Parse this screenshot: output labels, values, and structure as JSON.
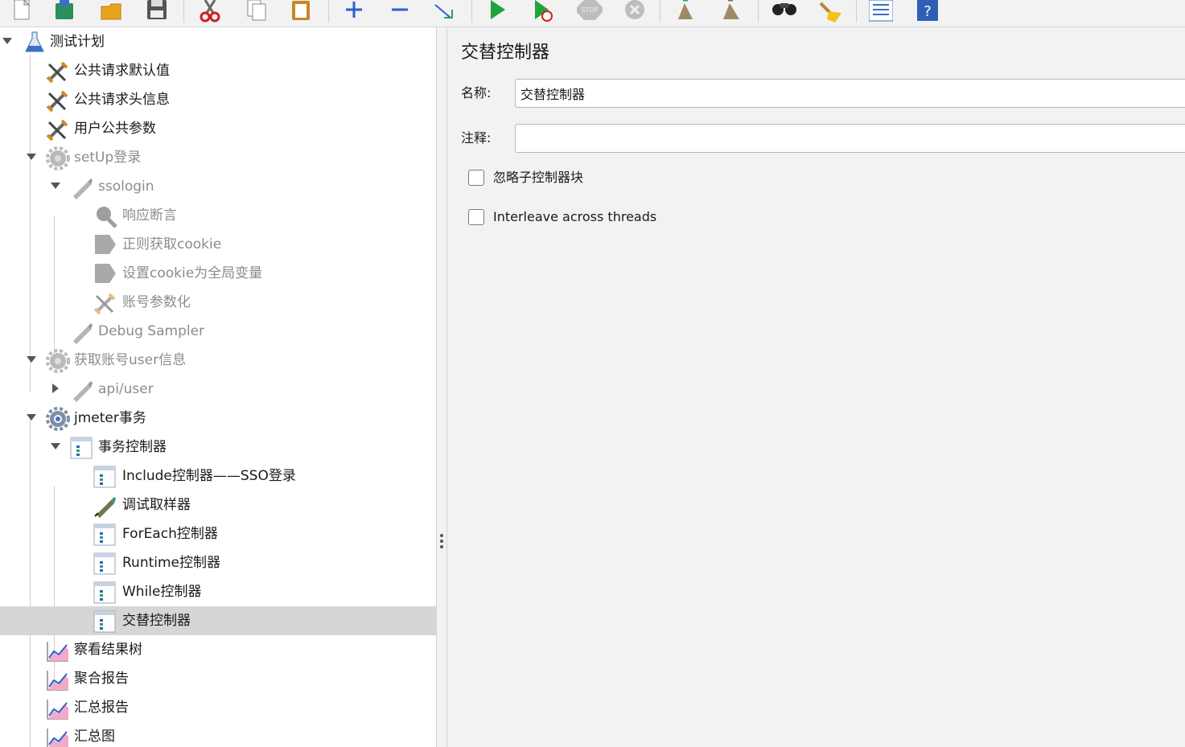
{
  "toolbar": {
    "buttons": [
      {
        "icon": "new-document-icon"
      },
      {
        "icon": "templates-icon"
      },
      {
        "icon": "open-folder-icon"
      },
      {
        "icon": "save-icon"
      },
      {
        "icon": "cut-icon"
      },
      {
        "icon": "copy-icon"
      },
      {
        "icon": "paste-icon"
      },
      {
        "icon": "expand-all-icon"
      },
      {
        "icon": "collapse-all-icon"
      },
      {
        "icon": "toggle-icon"
      },
      {
        "icon": "start-icon"
      },
      {
        "icon": "start-no-pauses-icon"
      },
      {
        "icon": "stop-icon",
        "text": "STOP"
      },
      {
        "icon": "shutdown-icon"
      },
      {
        "icon": "clear-icon"
      },
      {
        "icon": "clear-all-icon"
      },
      {
        "icon": "search-icon"
      },
      {
        "icon": "reset-search-icon"
      },
      {
        "icon": "function-helper-icon"
      },
      {
        "icon": "help-icon",
        "text": "?"
      }
    ]
  },
  "tree": {
    "items": [
      {
        "label": "测试计划",
        "icon": "test-plan-icon",
        "toggle": "open",
        "dim": false
      },
      {
        "label": "公共请求默认值",
        "icon": "config-tools-icon",
        "toggle": "",
        "dim": false
      },
      {
        "label": "公共请求头信息",
        "icon": "config-tools-icon",
        "toggle": "",
        "dim": false
      },
      {
        "label": "用户公共参数",
        "icon": "config-tools-icon",
        "toggle": "",
        "dim": false
      },
      {
        "label": "setUp登录",
        "icon": "thread-group-gear-icon",
        "toggle": "open",
        "dim": true
      },
      {
        "label": "ssologin",
        "icon": "sampler-pen-icon",
        "toggle": "open",
        "dim": true
      },
      {
        "label": "响应断言",
        "icon": "assertion-icon",
        "toggle": "",
        "dim": true
      },
      {
        "label": "正则获取cookie",
        "icon": "post-processor-icon",
        "toggle": "",
        "dim": true
      },
      {
        "label": "设置cookie为全局变量",
        "icon": "post-processor-icon",
        "toggle": "",
        "dim": true
      },
      {
        "label": "账号参数化",
        "icon": "config-tools-icon",
        "toggle": "",
        "dim": true
      },
      {
        "label": "Debug Sampler",
        "icon": "sampler-pen-icon",
        "toggle": "",
        "dim": true
      },
      {
        "label": "获取账号user信息",
        "icon": "thread-group-gear-icon",
        "toggle": "open",
        "dim": true
      },
      {
        "label": "api/user",
        "icon": "sampler-pen-icon",
        "toggle": "closed",
        "dim": true
      },
      {
        "label": "jmeter事务",
        "icon": "thread-group-gear-icon",
        "toggle": "open",
        "dim": false
      },
      {
        "label": "事务控制器",
        "icon": "controller-icon",
        "toggle": "open",
        "dim": false
      },
      {
        "label": "Include控制器——SSO登录",
        "icon": "controller-icon",
        "toggle": "",
        "dim": false
      },
      {
        "label": "调试取样器",
        "icon": "sampler-pen-icon",
        "toggle": "",
        "dim": false
      },
      {
        "label": "ForEach控制器",
        "icon": "controller-icon",
        "toggle": "",
        "dim": false
      },
      {
        "label": "Runtime控制器",
        "icon": "controller-icon",
        "toggle": "",
        "dim": false
      },
      {
        "label": "While控制器",
        "icon": "controller-icon",
        "toggle": "",
        "dim": false
      },
      {
        "label": "交替控制器",
        "icon": "controller-icon",
        "toggle": "",
        "dim": false,
        "selected": true
      },
      {
        "label": "察看结果树",
        "icon": "listener-graph-icon",
        "toggle": "",
        "dim": false
      },
      {
        "label": "聚合报告",
        "icon": "listener-graph-icon",
        "toggle": "",
        "dim": false
      },
      {
        "label": "汇总报告",
        "icon": "listener-graph-icon",
        "toggle": "",
        "dim": false
      },
      {
        "label": "汇总图",
        "icon": "listener-graph-icon",
        "toggle": "",
        "dim": false
      }
    ]
  },
  "panel": {
    "title": "交替控制器",
    "name_label": "名称:",
    "name_value": "交替控制器",
    "comment_label": "注释:",
    "comment_value": "",
    "checkbox_ignore_label": "忽略子控制器块",
    "checkbox_ignore_checked": false,
    "checkbox_interleave_label": "Interleave across threads",
    "checkbox_interleave_checked": false
  },
  "colors": {
    "selected_row": "#d6d6d6",
    "dim_text": "#8c8c8c",
    "start_green": "#1fa33a",
    "help_blue": "#2f5fb5"
  }
}
